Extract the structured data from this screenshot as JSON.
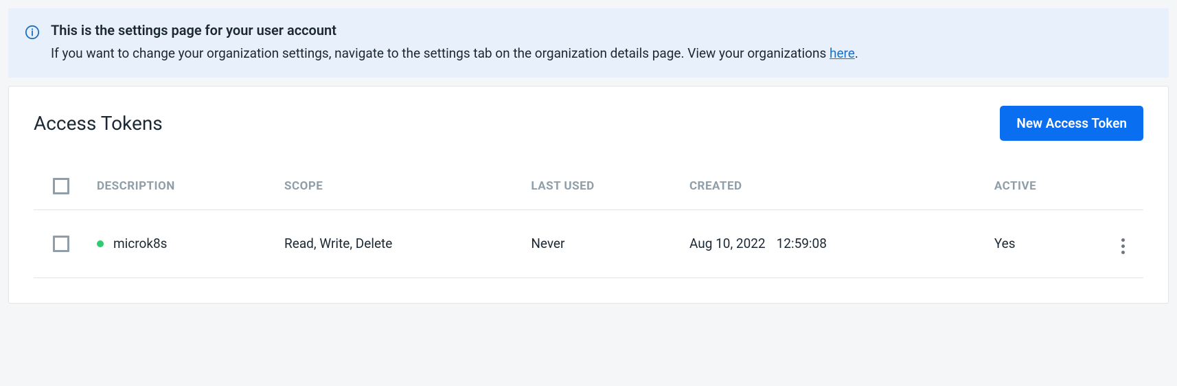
{
  "banner": {
    "title": "This is the settings page for your user account",
    "subtitle_prefix": "If you want to change your organization settings, navigate to the settings tab on the organization details page. View your organizations ",
    "link_text": "here",
    "suffix": "."
  },
  "card": {
    "title": "Access Tokens",
    "new_button": "New Access Token"
  },
  "table": {
    "headers": {
      "description": "DESCRIPTION",
      "scope": "SCOPE",
      "last_used": "LAST USED",
      "created": "CREATED",
      "active": "ACTIVE"
    },
    "rows": [
      {
        "description": "microk8s",
        "scope": "Read, Write, Delete",
        "last_used": "Never",
        "created_date": "Aug 10, 2022",
        "created_time": "12:59:08",
        "active": "Yes"
      }
    ]
  }
}
